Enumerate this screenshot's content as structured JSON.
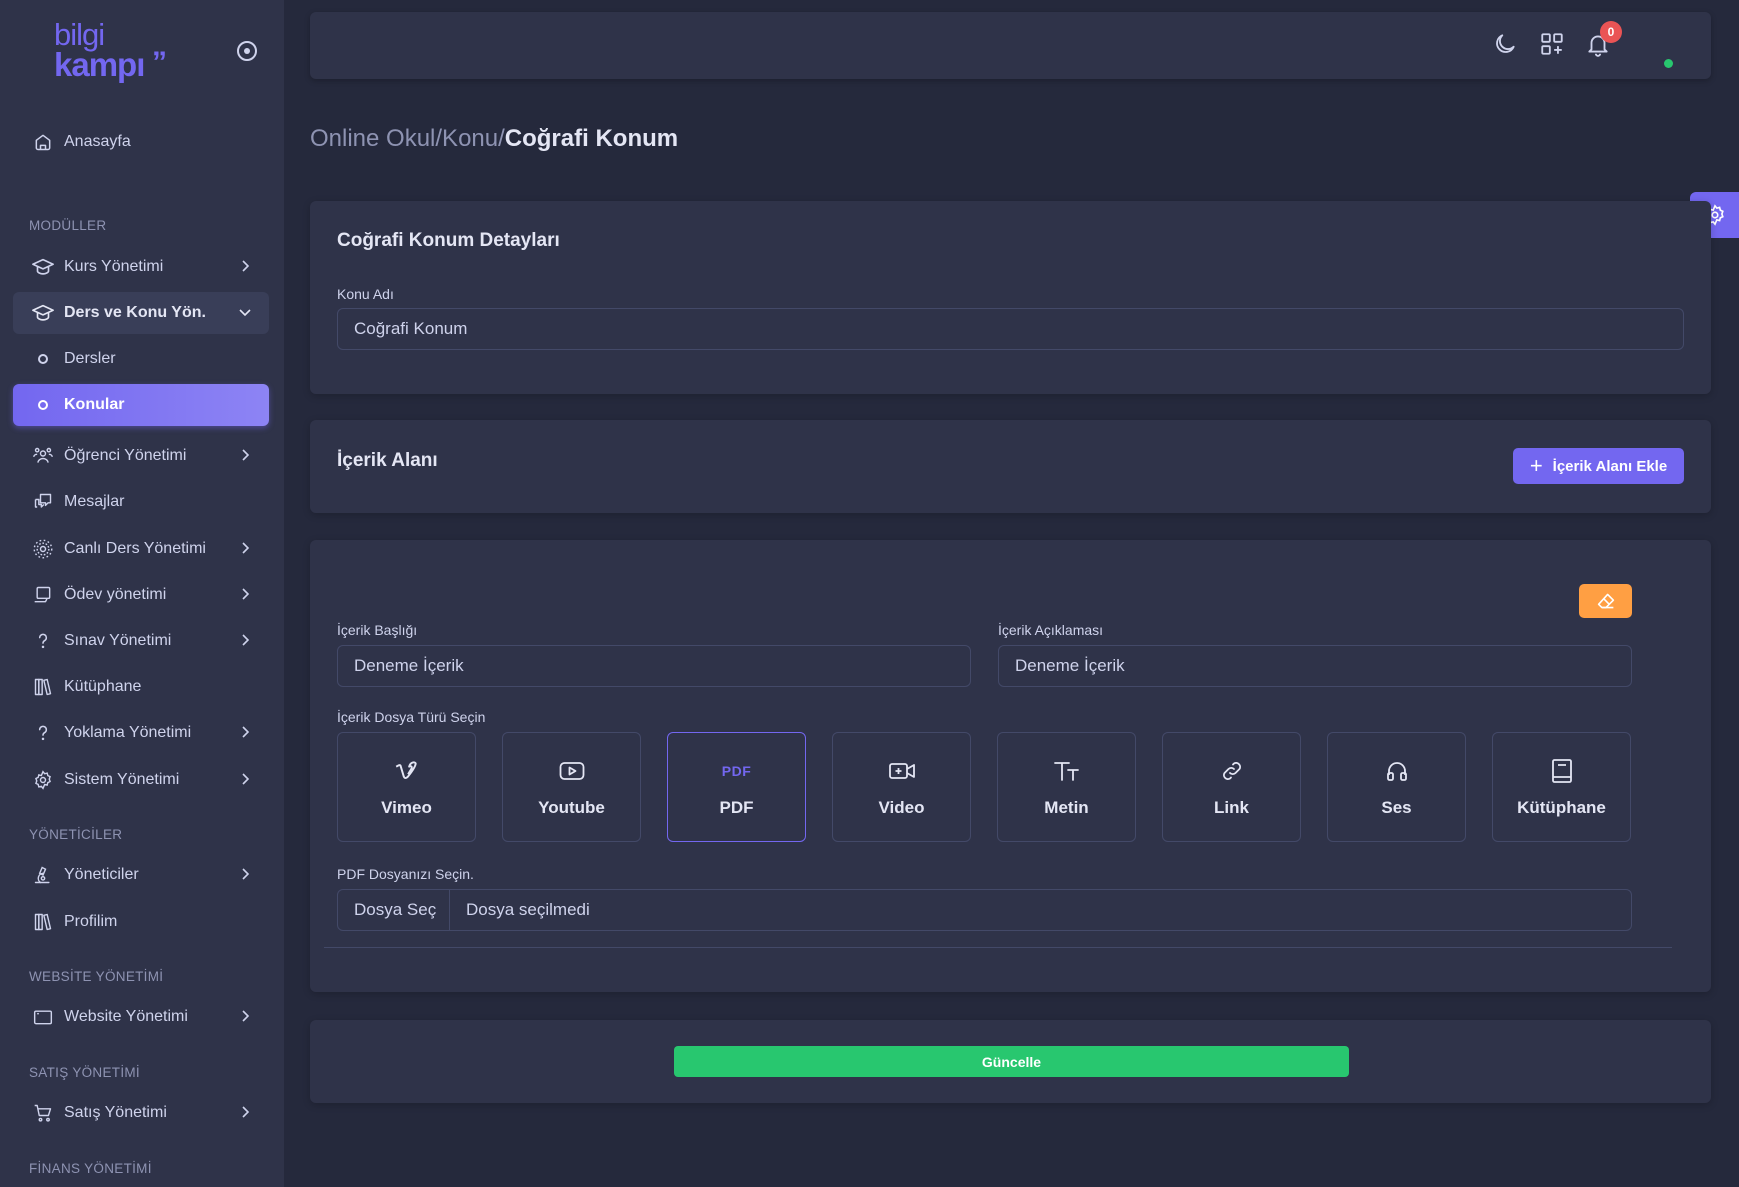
{
  "brand": {
    "line1": "bilgi",
    "line2": "kampı",
    "quote": "”"
  },
  "sidebar": {
    "home": "Anasayfa",
    "sections": {
      "modules": "MODÜLLER",
      "admins": "YÖNETİCİLER",
      "website": "WEBSİTE YÖNETİMİ",
      "sales": "SATIŞ YÖNETİMİ",
      "finance": "FİNANS YÖNETİMİ"
    },
    "items": {
      "course": "Kurs Yönetimi",
      "lesson_topic": "Ders ve Konu Yön.",
      "lessons": "Dersler",
      "topics": "Konular",
      "students": "Öğrenci Yönetimi",
      "messages": "Mesajlar",
      "live": "Canlı Ders Yönetimi",
      "homework": "Ödev yönetimi",
      "exam": "Sınav Yönetimi",
      "library": "Kütüphane",
      "attendance": "Yoklama Yönetimi",
      "system": "Sistem Yönetimi",
      "admins": "Yöneticiler",
      "profile": "Profilim",
      "website": "Website Yönetimi",
      "sales": "Satış Yönetimi"
    }
  },
  "topbar": {
    "notification_count": "0"
  },
  "breadcrumb": {
    "path": "Online Okul/Konu/",
    "current": "Coğrafi Konum"
  },
  "details_card": {
    "title": "Coğrafi Konum Detayları",
    "topic_name_label": "Konu Adı",
    "topic_name_value": "Coğrafi Konum"
  },
  "content_area_card": {
    "title": "İçerik Alanı",
    "add_button": "İçerik Alanı Ekle"
  },
  "content_item": {
    "title_label": "İçerik Başlığı",
    "title_value": "Deneme İçerik",
    "desc_label": "İçerik Açıklaması",
    "desc_value": "Deneme İçerik",
    "type_label": "İçerik Dosya Türü Seçin",
    "types": [
      "Vimeo",
      "Youtube",
      "PDF",
      "Video",
      "Metin",
      "Link",
      "Ses",
      "Kütüphane"
    ],
    "pdf_icon_text": "PDF",
    "selected_type": "PDF",
    "file_label": "PDF Dosyanızı Seçin.",
    "file_button": "Dosya Seç",
    "file_status": "Dosya seçilmedi"
  },
  "update_button": "Güncelle",
  "colors": {
    "primary": "#7367f0",
    "success": "#28c76f",
    "warning": "#ff9f43",
    "danger": "#ea5455",
    "background": "#25293c",
    "card": "#2f3349"
  }
}
